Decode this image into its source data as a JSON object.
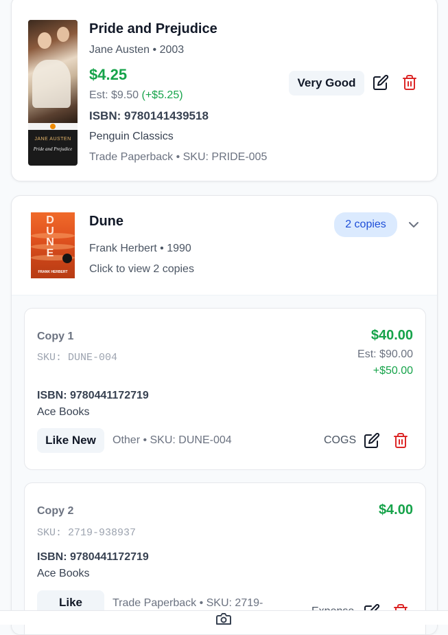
{
  "books": [
    {
      "title": "Pride and Prejudice",
      "author_year": "Jane Austen • 2003",
      "price": "$4.25",
      "est_label": "Est: $9.50",
      "est_gain": "(+$5.25)",
      "isbn": "ISBN: 9780141439518",
      "publisher": "Penguin Classics",
      "format_sku": "Trade Paperback • SKU: PRIDE-005",
      "condition": "Very Good",
      "cover": {
        "author": "JANE AUSTEN",
        "title": "Pride and Prejudice"
      }
    },
    {
      "title": "Dune",
      "author_year": "Frank Herbert • 1990",
      "hint": "Click to view 2 copies",
      "copies_badge": "2 copies",
      "cover": {
        "letters": "DUNE",
        "author": "FRANK HERBERT"
      },
      "copies": [
        {
          "label": "Copy 1",
          "sku": "SKU: DUNE-004",
          "price": "$40.00",
          "est": "Est: $90.00",
          "gain": "+$50.00",
          "isbn": "ISBN: 9780441172719",
          "publisher": "Ace Books",
          "condition": "Like New",
          "format_sku": "Other • SKU: DUNE-004",
          "tag": "COGS"
        },
        {
          "label": "Copy 2",
          "sku": "SKU: 2719-938937",
          "price": "$4.00",
          "isbn": "ISBN: 9780441172719",
          "publisher": "Ace Books",
          "condition": "Like",
          "format_sku": "Trade Paperback • SKU: 2719-",
          "tag": "Expense"
        }
      ]
    }
  ],
  "icons": {
    "edit": "edit-icon",
    "delete": "trash-icon",
    "expand": "chevron-down-icon",
    "camera": "camera-icon"
  },
  "colors": {
    "price_green": "#16a34a",
    "delete_red": "#dc2626",
    "badge_blue": "#1d4ed8"
  }
}
